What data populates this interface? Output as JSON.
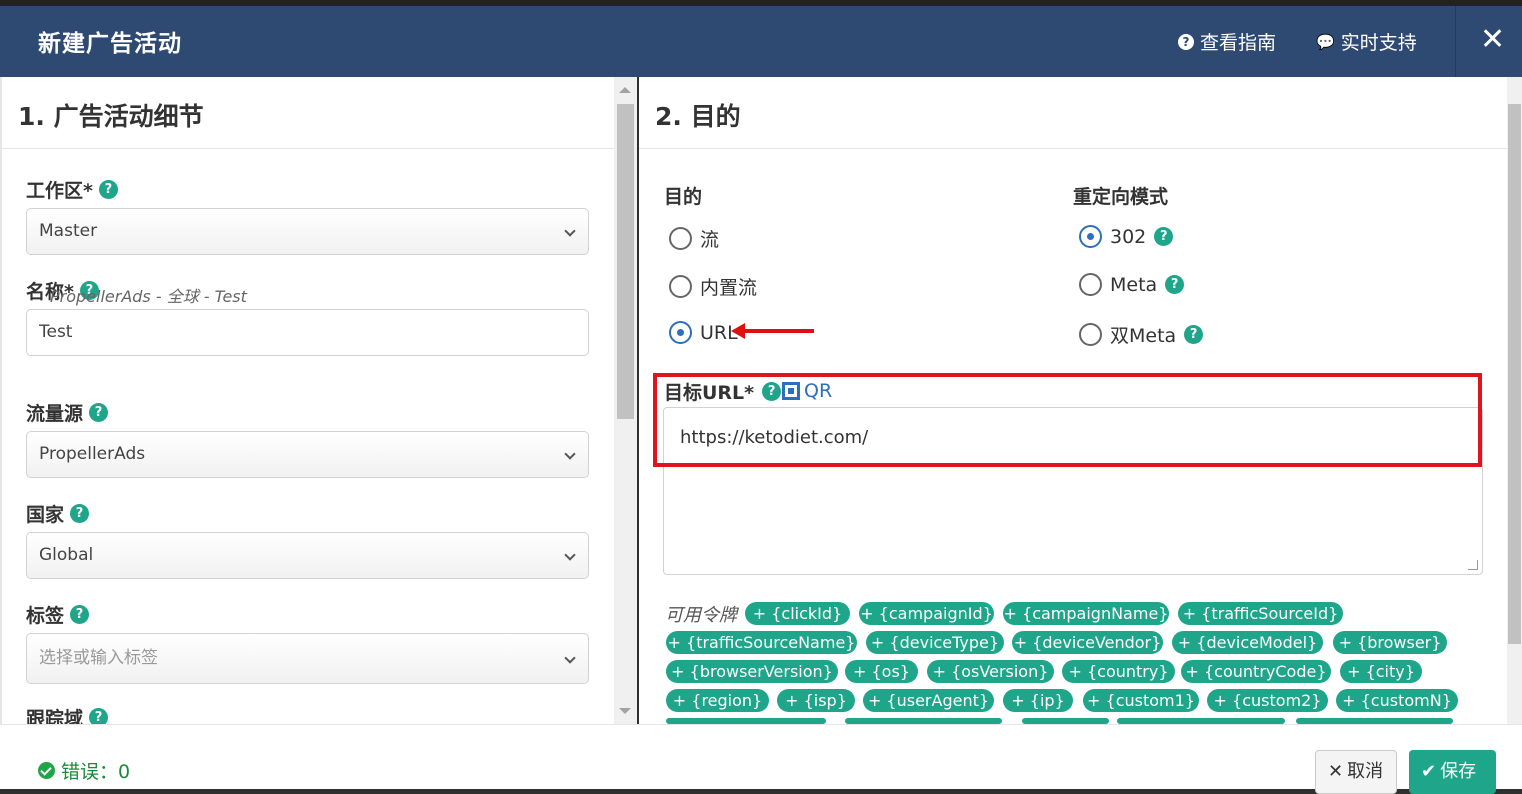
{
  "header": {
    "title": "新建广告活动",
    "guide_label": "查看指南",
    "support_label": "实时支持",
    "close_label": "✕"
  },
  "left": {
    "title": "1. 广告活动细节",
    "workspace": {
      "label": "工作区*",
      "value": "Master"
    },
    "name": {
      "label": "名称*",
      "value": "Test",
      "hint": "PropellerAds - 全球 - Test"
    },
    "traffic_source": {
      "label": "流量源",
      "value": "PropellerAds"
    },
    "country": {
      "label": "国家",
      "value": "Global"
    },
    "tags": {
      "label": "标签",
      "placeholder": "选择或输入标签"
    },
    "tracking_domain": {
      "label": "跟踪域"
    }
  },
  "right": {
    "title": "2. 目的",
    "destination": {
      "label": "目的",
      "options": [
        "流",
        "内置流",
        "URL"
      ],
      "selected": "URL"
    },
    "redirect": {
      "label": "重定向模式",
      "options": [
        "302",
        "Meta",
        "双Meta"
      ],
      "selected": "302"
    },
    "target_url": {
      "label": "目标URL*",
      "qr_label": "QR",
      "value": "https://ketodiet.com/"
    },
    "tokens": {
      "label": "可用令牌",
      "items": [
        "+ {clickId}",
        "+ {campaignId}",
        "+ {campaignName}",
        "+ {trafficSourceId}",
        "+ {trafficSourceName}",
        "+ {deviceType}",
        "+ {deviceVendor}",
        "+ {deviceModel}",
        "+ {browser}",
        "+ {browserVersion}",
        "+ {os}",
        "+ {osVersion}",
        "+ {country}",
        "+ {countryCode}",
        "+ {city}",
        "+ {region}",
        "+ {isp}",
        "+ {userAgent}",
        "+ {ip}",
        "+ {custom1}",
        "+ {custom2}",
        "+ {customN}"
      ]
    }
  },
  "footer": {
    "errors_label": "错误：0",
    "cancel_label": "取消",
    "save_label": "保存"
  },
  "colors": {
    "header_bg": "#2f4a72",
    "accent_green": "#1fa58a",
    "link_blue": "#2d6fbf",
    "highlight_red": "#e0141f"
  }
}
